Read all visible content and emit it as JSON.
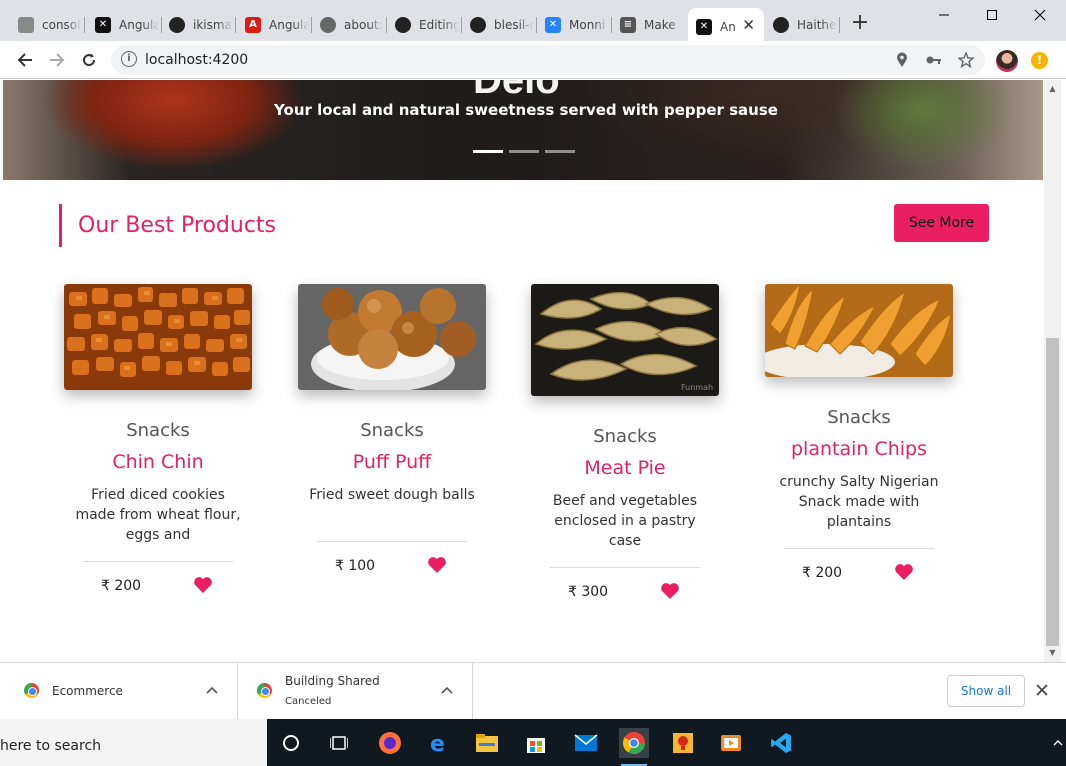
{
  "browser": {
    "tabs": [
      {
        "title": "consol",
        "icon": "generic"
      },
      {
        "title": "Angula",
        "icon": "angular-x"
      },
      {
        "title": "ikisma",
        "icon": "github"
      },
      {
        "title": "Angula",
        "icon": "angular-red"
      },
      {
        "title": "about:",
        "icon": "globe"
      },
      {
        "title": "Editing",
        "icon": "github"
      },
      {
        "title": "blesil-r",
        "icon": "github"
      },
      {
        "title": "Monni",
        "icon": "confluence"
      },
      {
        "title": "Make ",
        "icon": "doc"
      },
      {
        "title": "An",
        "icon": "angular-x",
        "active": true
      },
      {
        "title": "Haithe",
        "icon": "github"
      }
    ],
    "url": "localhost:4200"
  },
  "hero": {
    "title_fragment": "Delo",
    "caption": "Your local and natural sweetness served with pepper sause"
  },
  "section": {
    "title": "Our Best Products",
    "see_more": "See More"
  },
  "products": [
    {
      "category": "Snacks",
      "name": "Chin Chin",
      "description": "Fried diced cookies made from wheat flour, eggs and",
      "price": "₹ 200"
    },
    {
      "category": "Snacks",
      "name": "Puff Puff",
      "description": "Fried sweet dough balls",
      "price": "₹ 100"
    },
    {
      "category": "Snacks",
      "name": "Meat Pie",
      "description": "Beef and vegetables enclosed in a pastry case",
      "price": "₹ 300"
    },
    {
      "category": "Snacks",
      "name": "plantain Chips",
      "description": "crunchy Salty Nigerian Snack made with plantains",
      "price": "₹ 200"
    }
  ],
  "downloads": {
    "items": [
      {
        "name": "Ecommerce",
        "status": ""
      },
      {
        "name": "Building Shared",
        "status": "Canceled"
      }
    ],
    "show_all": "Show all"
  },
  "taskbar": {
    "search_text": "here to search"
  },
  "colors": {
    "accent": "#e91e63"
  }
}
